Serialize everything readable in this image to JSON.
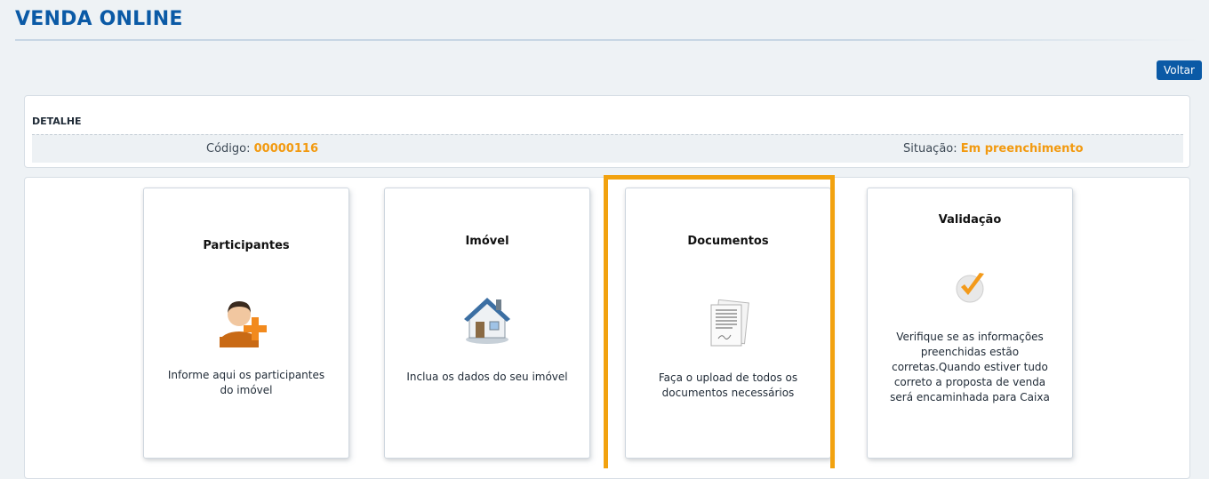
{
  "header": {
    "title": "VENDA ONLINE",
    "back_label": "Voltar"
  },
  "detail": {
    "heading": "DETALHE",
    "code_label": "Código:",
    "code_value": "00000116",
    "status_label": "Situação:",
    "status_value": "Em preenchimento"
  },
  "cards": [
    {
      "title": "Participantes",
      "description": "Informe aqui os participantes do imóvel",
      "icon": "person-add-icon"
    },
    {
      "title": "Imóvel",
      "description": "Inclua os dados do seu imóvel",
      "icon": "house-icon"
    },
    {
      "title": "Documentos",
      "description": "Faça o upload de todos os documentos necessários",
      "icon": "documents-icon"
    },
    {
      "title": "Validação",
      "description": "Verifique se as informações preenchidas estão corretas.Quando estiver tudo correto a proposta de venda será encaminhada para Caixa",
      "icon": "checkmark-icon"
    }
  ],
  "colors": {
    "brand_blue": "#0b5aa6",
    "accent_orange": "#f29a10",
    "highlight": "#f2a20f"
  }
}
